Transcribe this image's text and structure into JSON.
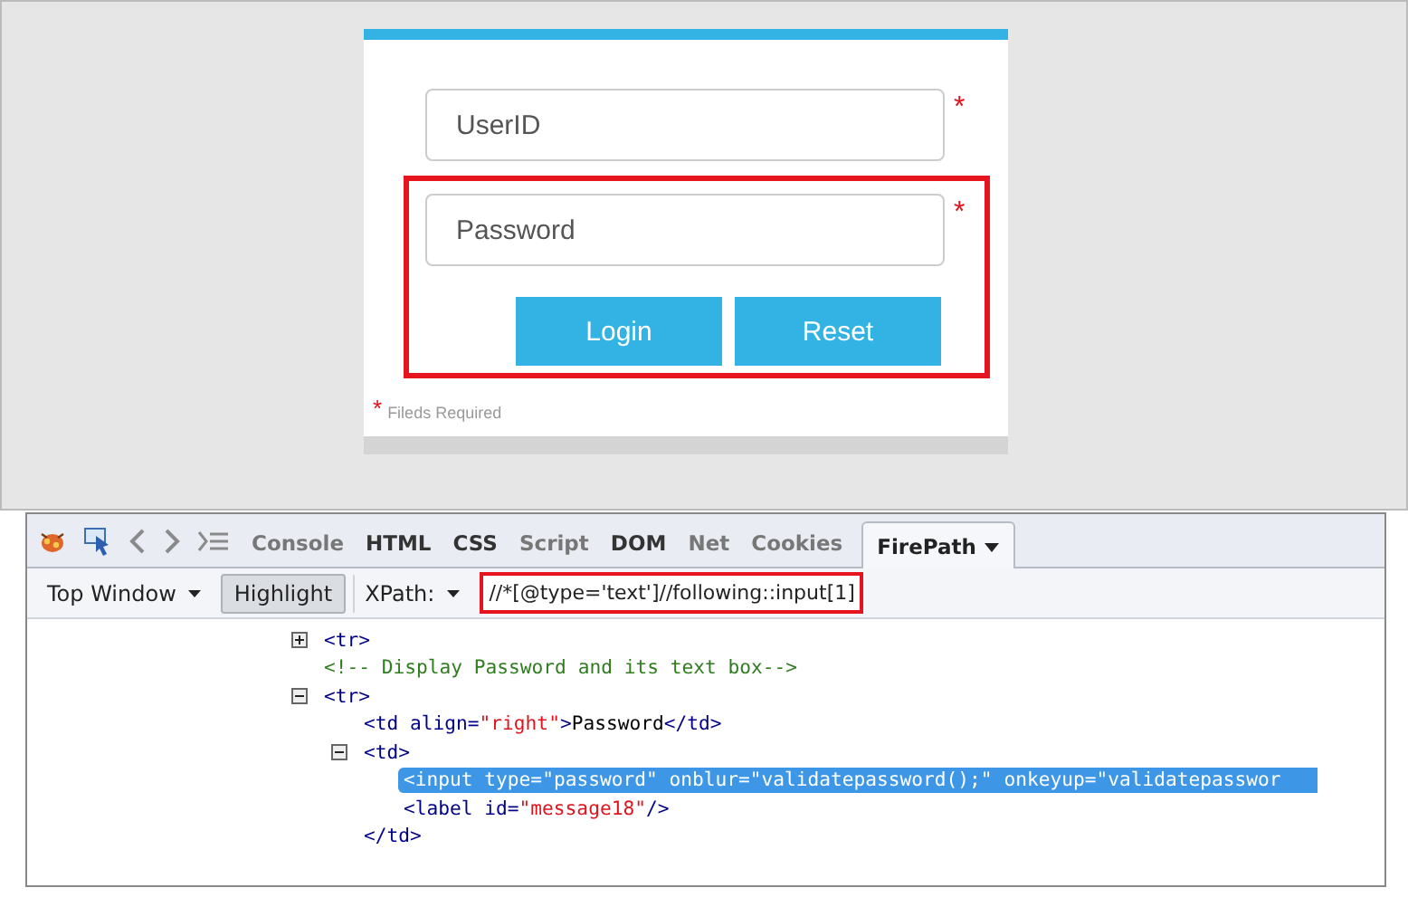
{
  "login_form": {
    "fields": [
      {
        "placeholder": "UserID",
        "required_mark": "*",
        "highlighted": false
      },
      {
        "placeholder": "Password",
        "required_mark": "*",
        "highlighted": true
      }
    ],
    "buttons": [
      "Login",
      "Reset"
    ],
    "footer": {
      "mark": "*",
      "text": "Fileds Required"
    }
  },
  "devtools": {
    "tabs": [
      {
        "label": "Console",
        "selected": false,
        "dim": true
      },
      {
        "label": "HTML",
        "selected": false,
        "dim": false
      },
      {
        "label": "CSS",
        "selected": false,
        "dim": false
      },
      {
        "label": "Script",
        "selected": false,
        "dim": true
      },
      {
        "label": "DOM",
        "selected": false,
        "dim": false
      },
      {
        "label": "Net",
        "selected": false,
        "dim": true
      },
      {
        "label": "Cookies",
        "selected": false,
        "dim": true
      },
      {
        "label": "FirePath",
        "selected": true,
        "dim": false
      }
    ],
    "toolbar": {
      "frame": "Top Window",
      "highlight": {
        "label": "Highlight",
        "on": true
      },
      "xpath_label": "XPath:",
      "xpath_value": "//*[@type='text']//following::input[1]"
    },
    "tree": [
      {
        "expanded": false,
        "tokens": [
          {
            "kind": "tag",
            "text": "<tr>"
          }
        ]
      },
      {
        "tokens": [
          {
            "kind": "comment",
            "text": "<!-- Display Password and its text box-->"
          }
        ]
      },
      {
        "expanded": true,
        "tokens": [
          {
            "kind": "tag",
            "text": "<tr>"
          }
        ],
        "children": [
          {
            "tokens": [
              {
                "kind": "tag",
                "text": "<td"
              },
              {
                "kind": "attr",
                "text": " align="
              },
              {
                "kind": "value",
                "text": "\"right\""
              },
              {
                "kind": "tag",
                "text": ">"
              },
              {
                "kind": "text",
                "text": "Password"
              },
              {
                "kind": "tag",
                "text": "</td>"
              }
            ]
          },
          {
            "expanded": true,
            "tokens": [
              {
                "kind": "tag",
                "text": "<td>"
              }
            ],
            "children": [
              {
                "selected": true,
                "tokens": [
                  {
                    "kind": "tag",
                    "text": "<input"
                  },
                  {
                    "kind": "attr",
                    "text": " type="
                  },
                  {
                    "kind": "value",
                    "text": "\"password\""
                  },
                  {
                    "kind": "attr",
                    "text": " onblur="
                  },
                  {
                    "kind": "value",
                    "text": "\"validatepassword();\""
                  },
                  {
                    "kind": "attr",
                    "text": " onkeyup="
                  },
                  {
                    "kind": "value",
                    "text": "\"validatepasswor"
                  }
                ]
              },
              {
                "selected": false,
                "tokens": [
                  {
                    "kind": "tag",
                    "text": "<label"
                  },
                  {
                    "kind": "attr",
                    "text": " id="
                  },
                  {
                    "kind": "value",
                    "text": "\"message18\""
                  },
                  {
                    "kind": "tag",
                    "text": "/>"
                  }
                ]
              }
            ],
            "end_tokens": [
              {
                "kind": "tag",
                "text": "</td>"
              }
            ]
          }
        ]
      }
    ]
  }
}
